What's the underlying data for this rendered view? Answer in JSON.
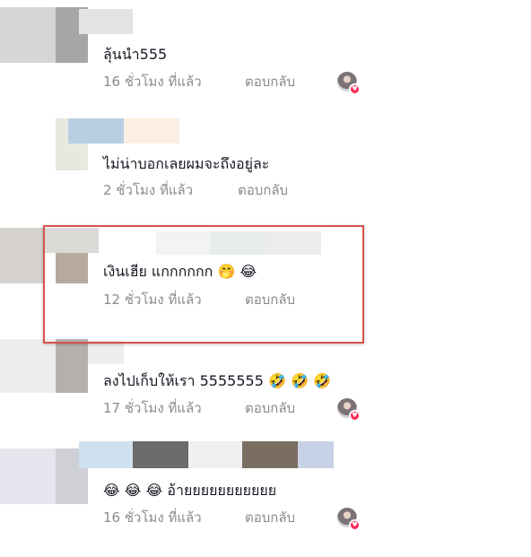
{
  "comments": [
    {
      "text": "ลุ้นนำ555",
      "time": "16 ชั่วโมง ที่แล้ว",
      "reply": "ตอบกลับ",
      "creator_liked": true,
      "highlighted": false
    },
    {
      "text": "ไม่น่าบอกเลยผมจะถึงอยู่ละ",
      "time": "2 ชั่วโมง ที่แล้ว",
      "reply": "ตอบกลับ",
      "creator_liked": false,
      "highlighted": false
    },
    {
      "text": "เงินเฮีย แกกกกกก",
      "emojis_after": "🤭 😂",
      "time": "12 ชั่วโมง ที่แล้ว",
      "reply": "ตอบกลับ",
      "creator_liked": false,
      "highlighted": true
    },
    {
      "text": "ลงไปเก็บให้เรา 5555555",
      "emojis_after": "🤣 🤣 🤣",
      "time": "17 ชั่วโมง ที่แล้ว",
      "reply": "ตอบกลับ",
      "creator_liked": true,
      "highlighted": false
    },
    {
      "emojis_before": "😂 😂 😂",
      "text": "อ้ายยยยยยยยยยย",
      "time": "16 ชั่วโมง ที่แล้ว",
      "reply": "ตอบกลับ",
      "creator_liked": true,
      "highlighted": false
    }
  ],
  "colors": {
    "text": "#161823",
    "meta": "#8a8b91",
    "highlight_border": "#d9534f",
    "like_heart": "#fe2c55"
  },
  "icons": {
    "creator_like": "creator-avatar-heart-icon"
  }
}
